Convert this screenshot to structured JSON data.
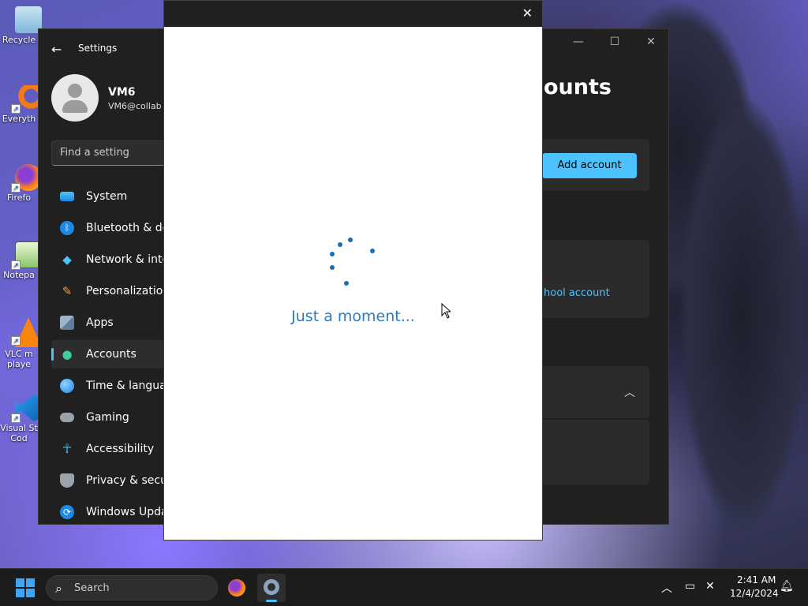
{
  "desktop": {
    "icons": [
      {
        "label": "Recycle",
        "name": "recycle-bin-icon"
      },
      {
        "label": "Everyth",
        "name": "everything-search-icon"
      },
      {
        "label": "Firefo",
        "name": "firefox-icon"
      },
      {
        "label": "Notepa",
        "name": "notepad-icon"
      },
      {
        "label": "VLC m\nplaye",
        "name": "vlc-icon"
      },
      {
        "label": "Visual St\nCod",
        "name": "vscode-icon"
      }
    ]
  },
  "settings": {
    "title": "Settings",
    "user": {
      "name": "VM6",
      "email": "VM6@collab"
    },
    "search_placeholder": "Find a setting",
    "nav": [
      {
        "label": "System",
        "icon": "system-icon"
      },
      {
        "label": "Bluetooth & dev",
        "icon": "bluetooth-icon"
      },
      {
        "label": "Network & inter",
        "icon": "network-icon"
      },
      {
        "label": "Personalization",
        "icon": "brush-icon"
      },
      {
        "label": "Apps",
        "icon": "apps-icon"
      },
      {
        "label": "Accounts",
        "icon": "accounts-icon",
        "active": true
      },
      {
        "label": "Time & languag",
        "icon": "time-language-icon"
      },
      {
        "label": "Gaming",
        "icon": "gaming-icon"
      },
      {
        "label": "Accessibility",
        "icon": "accessibility-icon"
      },
      {
        "label": "Privacy & securi",
        "icon": "shield-icon"
      },
      {
        "label": "Windows Updat",
        "icon": "update-icon"
      }
    ],
    "heading_partial": "ounts",
    "add_account_label": "Add account",
    "school_link_partial": "hool account"
  },
  "dialog": {
    "loading_text": "Just a moment..."
  },
  "taskbar": {
    "search_placeholder": "Search",
    "time": "2:41 AM",
    "date": "12/4/2024"
  },
  "colors": {
    "accent": "#4cc2ff",
    "dialog_text": "#2b7cc1",
    "settings_bg": "#202020"
  }
}
